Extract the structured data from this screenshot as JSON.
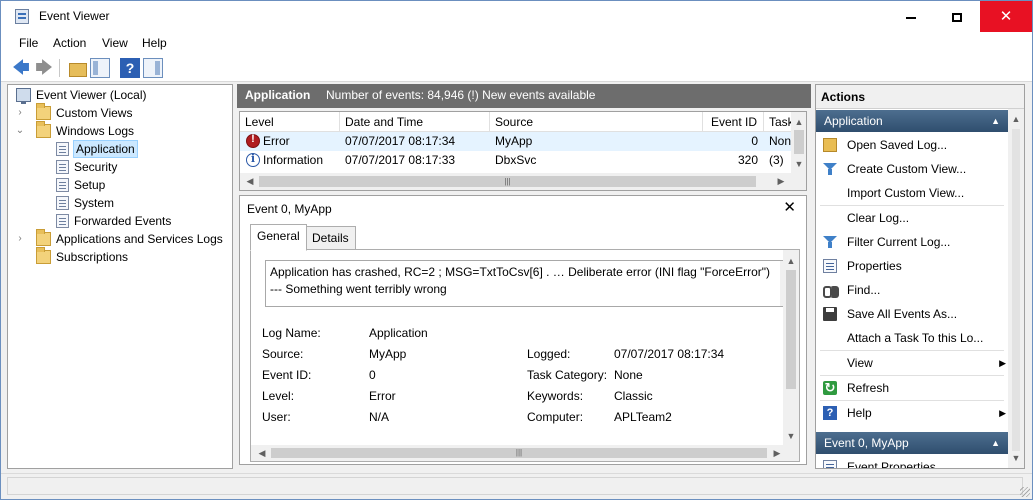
{
  "window": {
    "title": "Event Viewer",
    "minimize_glyph": "",
    "close_glyph": "✕",
    "accent": "#e81123"
  },
  "menubar": {
    "items": [
      {
        "label": "File"
      },
      {
        "label": "Action"
      },
      {
        "label": "View"
      },
      {
        "label": "Help"
      }
    ]
  },
  "toolbar": {
    "buttons": [
      {
        "icon": "back-arrow-icon"
      },
      {
        "icon": "forward-arrow-icon"
      },
      {
        "icon": "up-folder-icon"
      },
      {
        "icon": "show-hide-tree-icon"
      },
      {
        "icon": "help-icon"
      },
      {
        "icon": "show-hide-action-pane-icon"
      }
    ],
    "back_glyph": "🡄",
    "forward_glyph": "🡆",
    "help_glyph": "?"
  },
  "tree": {
    "root": "Event Viewer (Local)",
    "items": [
      {
        "label": "Custom Views"
      },
      {
        "label": "Windows Logs"
      },
      {
        "label": "Application"
      },
      {
        "label": "Security"
      },
      {
        "label": "Setup"
      },
      {
        "label": "System"
      },
      {
        "label": "Forwarded Events"
      },
      {
        "label": "Applications and Services Logs"
      },
      {
        "label": "Subscriptions"
      }
    ],
    "selected": "Application",
    "chev_collapsed": "›",
    "chev_expanded": "⌄"
  },
  "center": {
    "title": "Application",
    "count_text": "Number of events: 84,946 (!) New events available"
  },
  "grid": {
    "columns": [
      "Level",
      "Date and Time",
      "Source",
      "Event ID",
      "Task"
    ],
    "rows": [
      {
        "level": "Error",
        "datetime": "07/07/2017 08:17:34",
        "source": "MyApp",
        "event_id": "0",
        "task": "Non"
      },
      {
        "level": "Information",
        "datetime": "07/07/2017 08:17:33",
        "source": "DbxSvc",
        "event_id": "320",
        "task": "(3)"
      }
    ],
    "hscroll_thumb_glyph": "|||"
  },
  "detail": {
    "title": "Event 0, MyApp",
    "close_glyph": "✕",
    "tabs": [
      {
        "label": "General",
        "active": true
      },
      {
        "label": "Details",
        "active": false
      }
    ],
    "message": "Application has crashed, RC=2 ; MSG=TxtToCsv[6] . … Deliberate error (INI flag \"ForceError\") --- Something went terribly wrong",
    "fields": {
      "log_name_label": "Log Name:",
      "log_name": "Application",
      "source_label": "Source:",
      "source": "MyApp",
      "logged_label": "Logged:",
      "logged": "07/07/2017 08:17:34",
      "event_id_label": "Event ID:",
      "event_id": "0",
      "task_category_label": "Task Category:",
      "task_category": "None",
      "level_label": "Level:",
      "level": "Error",
      "keywords_label": "Keywords:",
      "keywords": "Classic",
      "user_label": "User:",
      "user": "N/A",
      "computer_label": "Computer:",
      "computer": "APLTeam2"
    }
  },
  "actions": {
    "header": "Actions",
    "section1": "Application",
    "items": [
      {
        "label": "Open Saved Log...",
        "icon": "open-folder-icon"
      },
      {
        "label": "Create Custom View...",
        "icon": "filter-icon"
      },
      {
        "label": "Import Custom View...",
        "icon": ""
      },
      {
        "label": "Clear Log...",
        "icon": ""
      },
      {
        "label": "Filter Current Log...",
        "icon": "filter-icon"
      },
      {
        "label": "Properties",
        "icon": "properties-icon"
      },
      {
        "label": "Find...",
        "icon": "binoculars-icon"
      },
      {
        "label": "Save All Events As...",
        "icon": "save-icon"
      },
      {
        "label": "Attach a Task To this Lo...",
        "icon": ""
      },
      {
        "label": "View",
        "icon": "",
        "submenu": true
      },
      {
        "label": "Refresh",
        "icon": "refresh-icon"
      },
      {
        "label": "Help",
        "icon": "help-icon",
        "submenu": true
      }
    ],
    "section2": "Event 0, MyApp",
    "section2_items": [
      {
        "label": "Event Properties"
      }
    ],
    "up_arrow": "▲",
    "right_arrow": "▶"
  },
  "scroll": {
    "up": "▲",
    "down": "▼",
    "left": "◀",
    "right": "▶"
  }
}
